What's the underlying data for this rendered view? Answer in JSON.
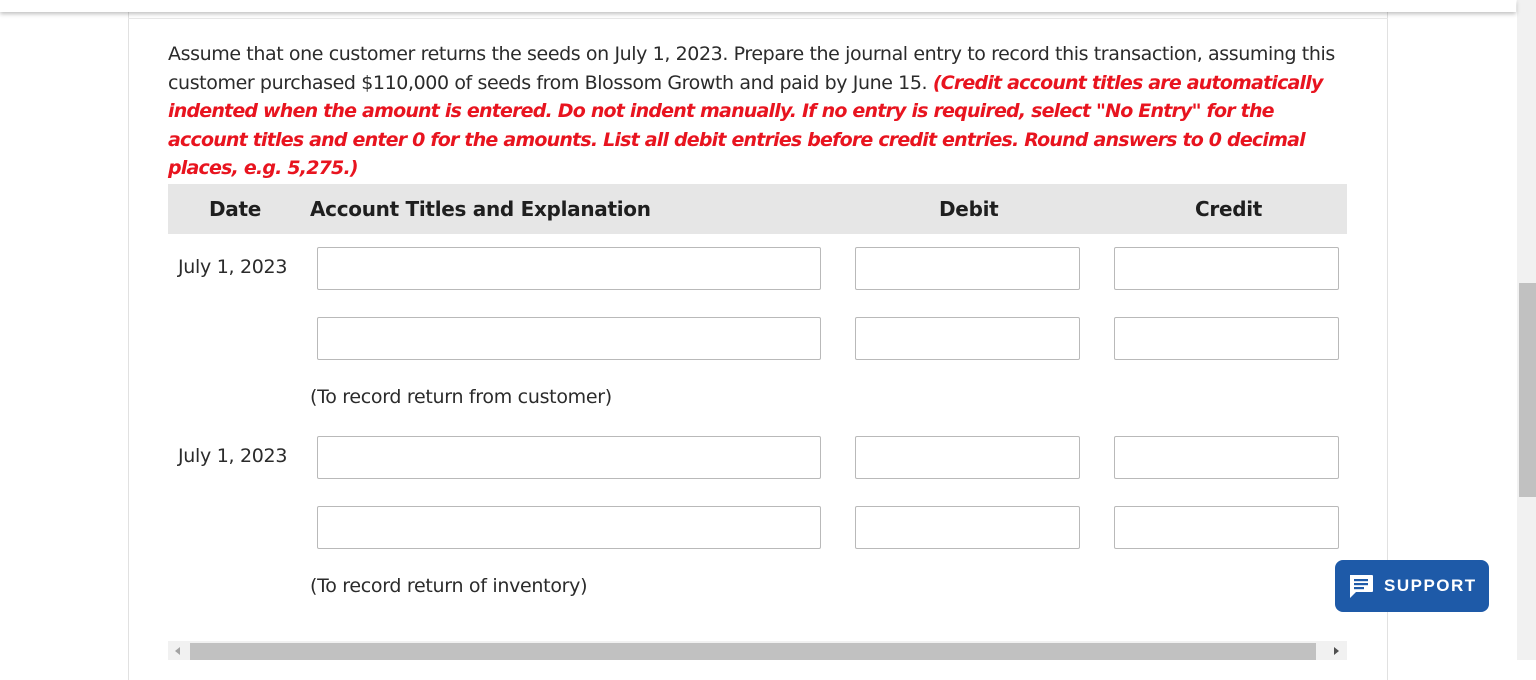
{
  "question": {
    "text": "Assume that one customer returns the seeds on July 1, 2023. Prepare the journal entry to record this transaction, assuming this customer purchased $110,000 of seeds from Blossom Growth and paid by June 15.",
    "instructions": "(Credit account titles are automatically indented when the amount is entered. Do not indent manually. If no entry is required, select \"No Entry\" for the account titles and enter 0 for the amounts. List all debit entries before credit entries. Round answers to 0 decimal places, e.g. 5,275.)"
  },
  "table": {
    "headers": {
      "date": "Date",
      "account": "Account Titles and Explanation",
      "debit": "Debit",
      "credit": "Credit"
    },
    "entries": [
      {
        "date": "July 1, 2023",
        "note": "(To record return from customer)",
        "rows": [
          {
            "account": "",
            "debit": "",
            "credit": ""
          },
          {
            "account": "",
            "debit": "",
            "credit": ""
          }
        ]
      },
      {
        "date": "July 1, 2023",
        "note": "(To record return of inventory)",
        "rows": [
          {
            "account": "",
            "debit": "",
            "credit": ""
          },
          {
            "account": "",
            "debit": "",
            "credit": ""
          }
        ]
      }
    ]
  },
  "support": {
    "label": "SUPPORT",
    "icon": "chat-bubble-icon"
  },
  "colors": {
    "instruction_red": "#e8141f",
    "header_gray": "#e6e6e6",
    "support_blue": "#1e5aa8"
  }
}
